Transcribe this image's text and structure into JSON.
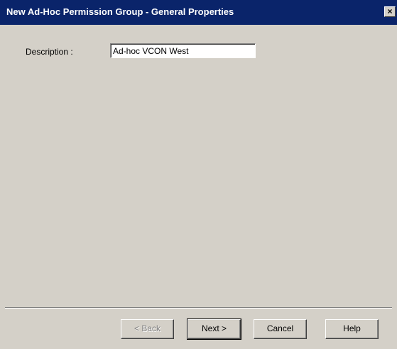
{
  "window": {
    "title": "New Ad-Hoc Permission Group - General Properties",
    "close_glyph": "×",
    "close_icon": "close-icon"
  },
  "form": {
    "description_label": "Description :",
    "description_value": "Ad-hoc VCON West"
  },
  "buttons": {
    "back": "< Back",
    "back_enabled": false,
    "next": "Next >",
    "cancel": "Cancel",
    "help": "Help"
  },
  "colors": {
    "titlebar": "#0a246a",
    "face": "#d4d0c8",
    "disabled_text": "#808080"
  }
}
